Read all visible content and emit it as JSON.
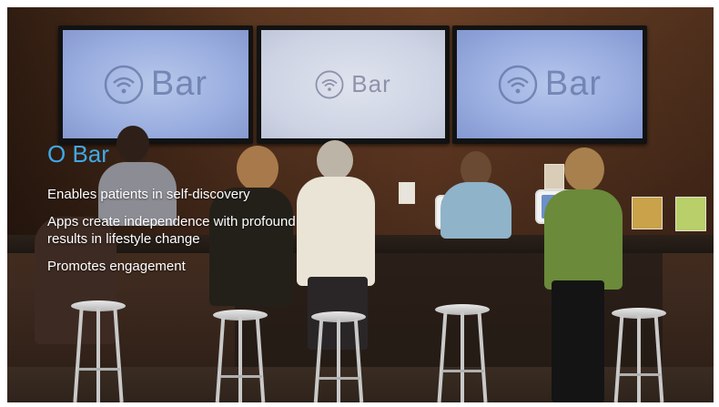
{
  "slide": {
    "title": "O Bar",
    "bullets": [
      "Enables patients in self-discovery",
      "Apps create independence with profound results in lifestyle change",
      "Promotes engagement"
    ]
  },
  "screens": [
    {
      "logo_text": "Bar"
    },
    {
      "logo_text": "Bar"
    },
    {
      "logo_text": "Bar"
    }
  ],
  "colors": {
    "title": "#3fa9e8",
    "bullet_text": "#ffffff",
    "wall": "#5a3520"
  },
  "icons": [
    "wifi-icon"
  ]
}
